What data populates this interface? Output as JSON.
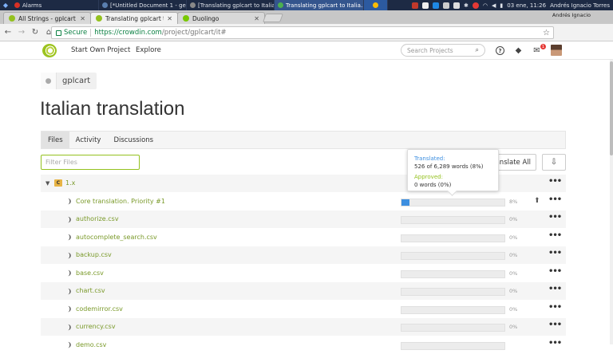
{
  "taskbar": {
    "tasks": [
      {
        "label": "Alarms",
        "color": "#d93025",
        "active": false
      },
      {
        "label": "[*Untitled Document 1 - ge...",
        "color": "#5a7fb0",
        "active": false
      },
      {
        "label": "[Translating gplcart to Italia...",
        "color": "#888888",
        "active": false
      },
      {
        "label": "Translating gplcart to Italia...",
        "color": "#4caf50",
        "active": true
      }
    ],
    "clock": "03 ene, 11:26",
    "user": "Andrés Ignacio Torres"
  },
  "browser": {
    "tabs": [
      {
        "label": "All Strings - gplcart - Cr",
        "favicon_color": "#94c11f",
        "active": false
      },
      {
        "label": "Translating gplcart to It",
        "favicon_color": "#94c11f",
        "active": true
      },
      {
        "label": "Duolingo",
        "favicon_color": "#78c800",
        "active": false
      }
    ],
    "profile_name": "Andrés Ignacio",
    "secure_label": "Secure",
    "url_host": "https://crowdin.com",
    "url_path": "/project/gplcart/it#"
  },
  "header": {
    "nav": [
      "Start Own Project",
      "Explore"
    ],
    "search_placeholder": "Search Projects",
    "notification_count": "1"
  },
  "breadcrumb": {
    "label": "gplcart"
  },
  "page": {
    "title": "Italian translation",
    "tabs": [
      "Files",
      "Activity",
      "Discussions"
    ],
    "filter_placeholder": "Filter Files",
    "translate_all": "Translate All"
  },
  "tooltip": {
    "translated_label": "Translated:",
    "translated_value": "526 of 6,289 words (8%)",
    "approved_label": "Approved:",
    "approved_value": "0 words (0%)"
  },
  "files": [
    {
      "name": "1.x",
      "type": "folder",
      "progress": null,
      "pct": ""
    },
    {
      "name": "Core translation. Priority #1",
      "type": "file",
      "progress": 0.08,
      "pct": "8%"
    },
    {
      "name": "authorize.csv",
      "type": "file",
      "progress": 0,
      "pct": "0%"
    },
    {
      "name": "autocomplete_search.csv",
      "type": "file",
      "progress": 0,
      "pct": "0%"
    },
    {
      "name": "backup.csv",
      "type": "file",
      "progress": 0,
      "pct": "0%"
    },
    {
      "name": "base.csv",
      "type": "file",
      "progress": 0,
      "pct": "0%"
    },
    {
      "name": "chart.csv",
      "type": "file",
      "progress": 0,
      "pct": "0%"
    },
    {
      "name": "codemirror.csv",
      "type": "file",
      "progress": 0,
      "pct": "0%"
    },
    {
      "name": "currency.csv",
      "type": "file",
      "progress": 0,
      "pct": "0%"
    },
    {
      "name": "demo.csv",
      "type": "file",
      "progress": 0,
      "pct": ""
    }
  ],
  "colors": {
    "accent": "#94c11f",
    "progress": "#3d8fe0"
  }
}
